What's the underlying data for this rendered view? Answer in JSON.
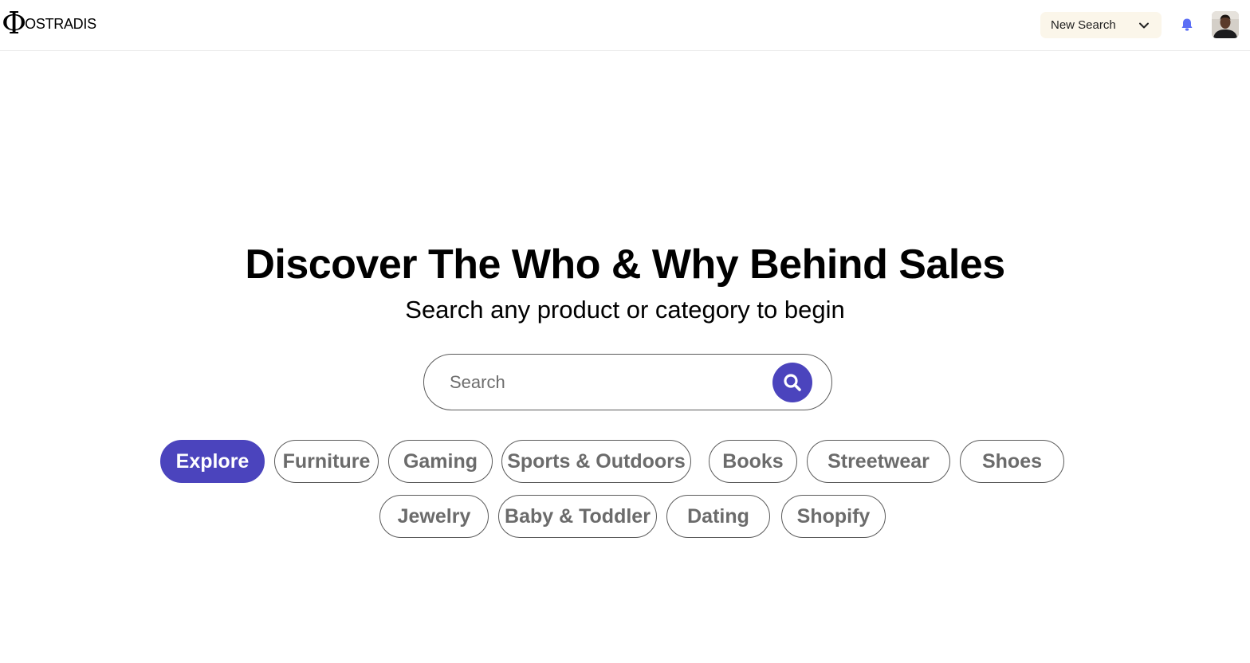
{
  "header": {
    "logo_symbol": "Φ",
    "logo_text": "OSTRADIS",
    "new_search_label": "New Search",
    "bell_icon": "bell-icon",
    "avatar_icon": "user-avatar"
  },
  "hero": {
    "title": "Discover The Who & Why Behind Sales",
    "subtitle": "Search any product or category to begin"
  },
  "search": {
    "placeholder": "Search",
    "value": "",
    "button_icon": "search-icon"
  },
  "categories": [
    {
      "label": "Explore",
      "active": true
    },
    {
      "label": "Furniture",
      "active": false
    },
    {
      "label": "Gaming",
      "active": false
    },
    {
      "label": "Sports & Outdoors",
      "active": false
    },
    {
      "label": "Books",
      "active": false
    },
    {
      "label": "Streetwear",
      "active": false
    },
    {
      "label": "Shoes",
      "active": false
    },
    {
      "label": "Jewelry",
      "active": false
    },
    {
      "label": "Baby & Toddler",
      "active": false
    },
    {
      "label": "Dating",
      "active": false
    },
    {
      "label": "Shopify",
      "active": false
    }
  ],
  "colors": {
    "accent": "#4b44bd",
    "bell": "#5b6ef5",
    "dropdown_bg": "#fbf6ea",
    "chip_text": "#6b6b6b"
  }
}
